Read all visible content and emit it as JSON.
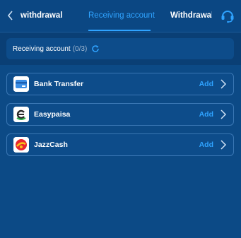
{
  "header": {
    "tabs": [
      {
        "label": "t withdrawal"
      },
      {
        "label": "Receiving account"
      },
      {
        "label": "Withdrawal I"
      }
    ],
    "active_tab": 1,
    "accent_color": "#2fa3ff"
  },
  "account_summary": {
    "title": "Receiving account",
    "count": "(0/3)"
  },
  "methods": [
    {
      "name": "Bank Transfer",
      "action": "Add",
      "icon": "bank-card-icon"
    },
    {
      "name": "Easypaisa",
      "action": "Add",
      "icon": "easypaisa-logo"
    },
    {
      "name": "JazzCash",
      "action": "Add",
      "icon": "jazzcash-logo"
    }
  ],
  "icons": {
    "back": "chevron-left-icon",
    "support": "headset-icon",
    "refresh": "refresh-icon",
    "row_arrow": "chevron-right-icon"
  }
}
